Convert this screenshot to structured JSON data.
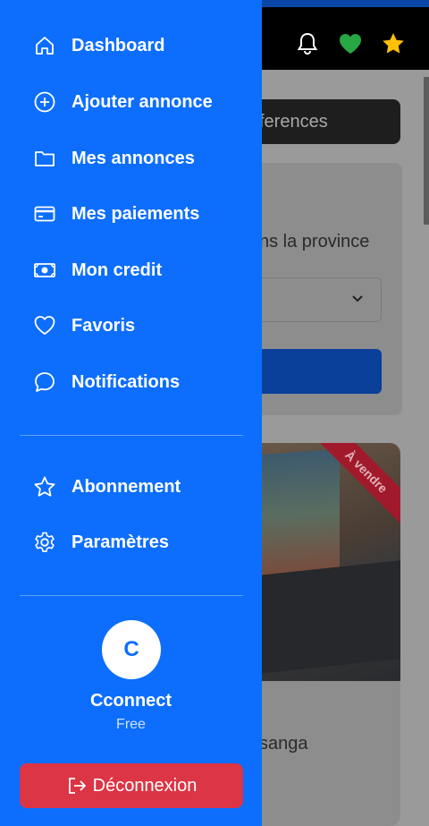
{
  "background": {
    "search_text": "ferences",
    "card_text": "ns la province",
    "listing_badge": "À vendre",
    "listing_location": "sanga",
    "header_icons": [
      "bell-icon",
      "heart-icon",
      "star-icon"
    ]
  },
  "drawer": {
    "primary_items": [
      {
        "label": "Dashboard",
        "icon": "home-icon"
      },
      {
        "label": "Ajouter annonce",
        "icon": "plus-circle-icon"
      },
      {
        "label": "Mes annonces",
        "icon": "folder-icon"
      },
      {
        "label": "Mes paiements",
        "icon": "credit-card-icon"
      },
      {
        "label": "Mon credit",
        "icon": "cash-icon"
      },
      {
        "label": "Favoris",
        "icon": "heart-outline-icon"
      },
      {
        "label": "Notifications",
        "icon": "chat-bubble-icon"
      }
    ],
    "secondary_items": [
      {
        "label": "Abonnement",
        "icon": "star-outline-icon"
      },
      {
        "label": "Paramètres",
        "icon": "gear-icon"
      }
    ],
    "user": {
      "initial": "C",
      "name": "Cconnect",
      "plan": "Free"
    },
    "logout_label": "Déconnexion"
  },
  "colors": {
    "drawer_bg": "#0d6efd",
    "logout_bg": "#dc3545",
    "heart": "#28a745",
    "star": "#ffc107"
  }
}
